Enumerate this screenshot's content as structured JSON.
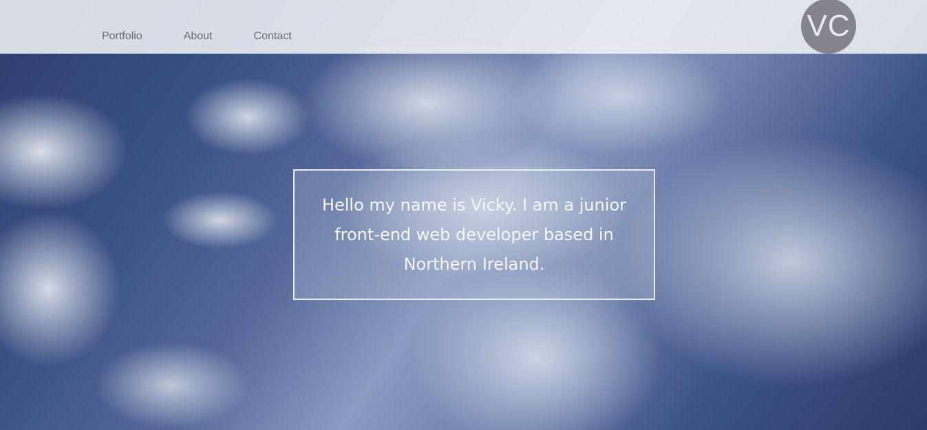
{
  "header": {
    "nav": [
      {
        "label": "Portfolio"
      },
      {
        "label": "About"
      },
      {
        "label": "Contact"
      }
    ],
    "logo_initials": "VC"
  },
  "hero": {
    "intro_text": "Hello my name is Vicky. I am a junior front-end web developer based in Northern Ireland."
  },
  "colors": {
    "header_bg": "#f4f5f7",
    "nav_text": "#6a6c72",
    "logo_bg": "#73737d",
    "intro_text": "#f6f7fb"
  }
}
